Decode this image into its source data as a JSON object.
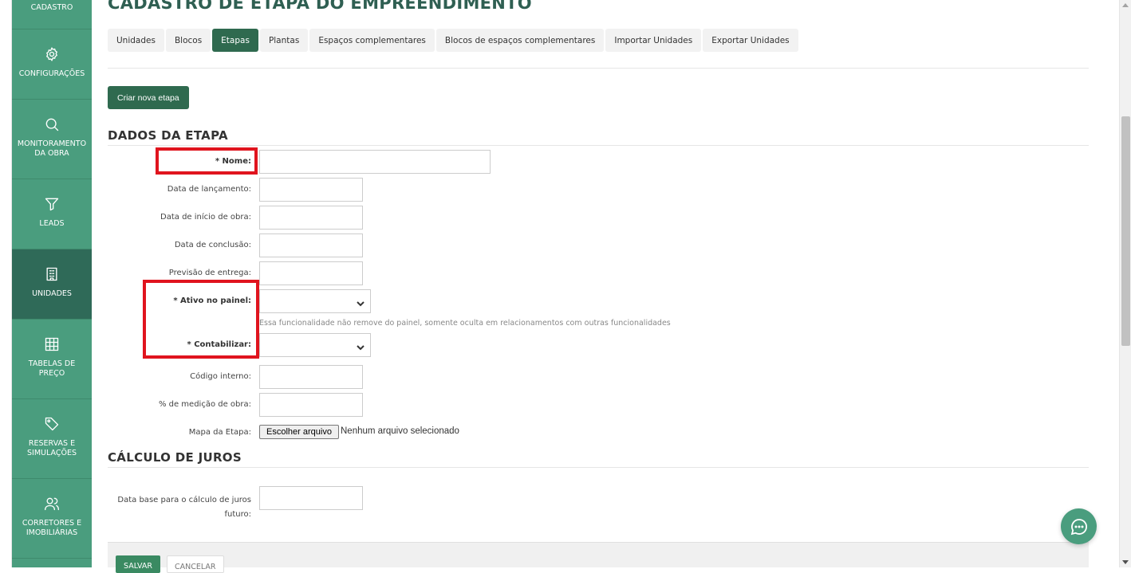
{
  "sidebar": {
    "items": [
      {
        "label": "CADASTRO",
        "icon": "document-icon"
      },
      {
        "label": "CONFIGURAÇÕES",
        "icon": "gear-icon"
      },
      {
        "label": "MONITORAMENTO\nDA OBRA",
        "icon": "search-icon"
      },
      {
        "label": "LEADS",
        "icon": "funnel-icon"
      },
      {
        "label": "UNIDADES",
        "icon": "building-icon",
        "active": true
      },
      {
        "label": "TABELAS DE\nPREÇO",
        "icon": "grid-icon"
      },
      {
        "label": "RESERVAS E\nSIMULAÇÕES",
        "icon": "tag-icon"
      },
      {
        "label": "CORRETORES E\nIMOBILIÁRIAS",
        "icon": "users-icon"
      }
    ]
  },
  "page": {
    "title": "CADASTRO DE ETAPA DO EMPREENDIMENTO"
  },
  "tabs": [
    {
      "label": "Unidades"
    },
    {
      "label": "Blocos"
    },
    {
      "label": "Etapas",
      "active": true
    },
    {
      "label": "Plantas"
    },
    {
      "label": "Espaços complementares"
    },
    {
      "label": "Blocos de espaços complementares"
    },
    {
      "label": "Importar Unidades"
    },
    {
      "label": "Exportar Unidades"
    }
  ],
  "actions": {
    "create_label": "Criar nova etapa"
  },
  "section_dados": {
    "title": "DADOS DA ETAPA"
  },
  "form": {
    "nome": {
      "label": "* Nome:",
      "value": ""
    },
    "data_lancamento": {
      "label": "Data de lançamento:",
      "value": ""
    },
    "data_inicio_obra": {
      "label": "Data de início de obra:",
      "value": ""
    },
    "data_conclusao": {
      "label": "Data de conclusão:",
      "value": ""
    },
    "previsao_entrega": {
      "label": "Previsão de entrega:",
      "value": ""
    },
    "ativo_painel": {
      "label": "* Ativo no painel:",
      "value": "",
      "help": "Essa funcionalidade não remove do painel, somente oculta em relacionamentos com outras funcionalidades"
    },
    "contabilizar": {
      "label": "* Contabilizar:",
      "value": ""
    },
    "codigo_interno": {
      "label": "Código interno:",
      "value": ""
    },
    "medicao_obra": {
      "label": "% de medição de obra:",
      "value": ""
    },
    "mapa_etapa": {
      "label": "Mapa da Etapa:",
      "button": "Escolher arquivo",
      "status": "Nenhum arquivo selecionado"
    }
  },
  "section_juros": {
    "title": "CÁLCULO DE JUROS"
  },
  "juros": {
    "data_base": {
      "label_line1": "Data base para o cálculo de juros",
      "label_line2": "futuro:",
      "value": ""
    }
  },
  "footer": {
    "save_label": "SALVAR",
    "cancel_label": "CANCELAR"
  },
  "colors": {
    "primary": "#2f6a4f",
    "sidebar": "#4a9d7e",
    "sidebar_active": "#2f6a58",
    "callout": "#e0141e"
  }
}
